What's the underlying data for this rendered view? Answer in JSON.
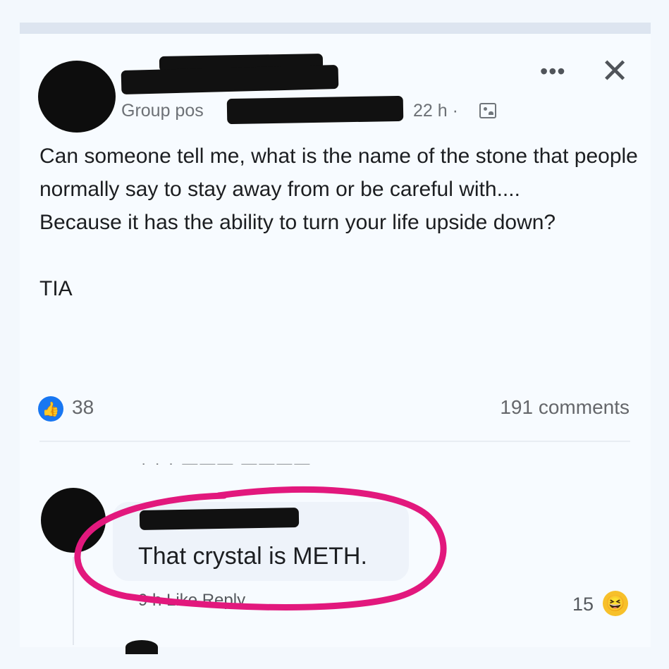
{
  "post": {
    "group_label": "Group pos",
    "time": "22 h ·",
    "more_icon": "more-horizontal-icon",
    "more_glyph": "•••",
    "close_icon": "close-icon",
    "close_glyph": "✕",
    "audience_icon": "members-icon",
    "text_lines": [
      "Can someone tell me, what is the name of the stone that people normally say to stay away from or be careful with....",
      "Because it has the ability to turn your life upside down?"
    ],
    "signoff": "TIA",
    "like_count": "38",
    "comments_label": "191 comments"
  },
  "comment": {
    "text": "That crystal is METH.",
    "actions": "9 h  Like  Reply",
    "reaction_count": "15",
    "reaction_icon": "haha-icon"
  },
  "colors": {
    "accent": "#1877f2",
    "annotation": "#e2187d",
    "background": "#f3f8fd"
  }
}
